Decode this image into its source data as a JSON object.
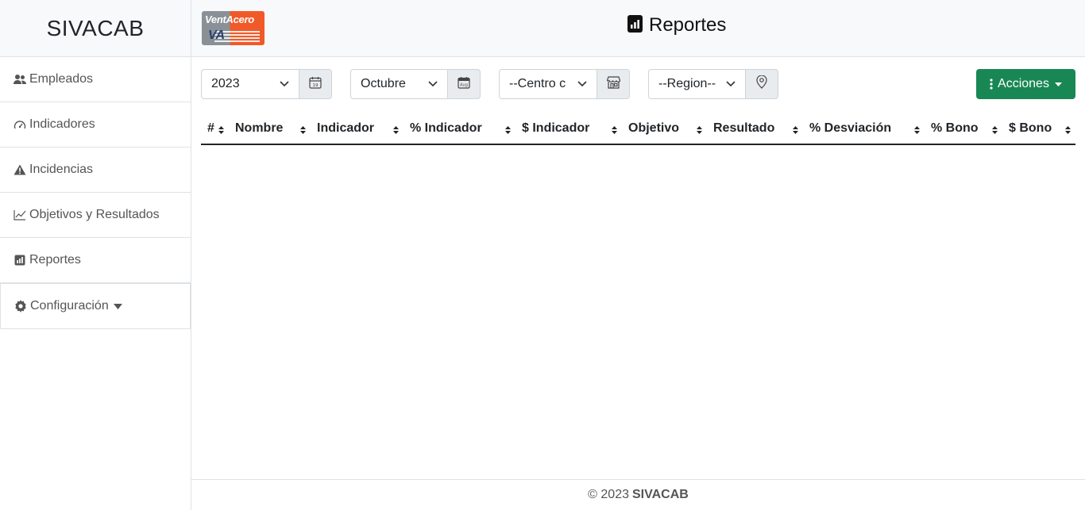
{
  "app": {
    "brand": "SIVACAB"
  },
  "sidebar": {
    "items": [
      {
        "label": "Empleados",
        "icon": "people-icon"
      },
      {
        "label": "Indicadores",
        "icon": "speedometer-icon"
      },
      {
        "label": "Incidencias",
        "icon": "warning-icon"
      },
      {
        "label": "Objetivos y Resultados",
        "icon": "line-chart-icon"
      },
      {
        "label": "Reportes",
        "icon": "report-chart-icon"
      },
      {
        "label": "Configuración",
        "icon": "gear-icon"
      }
    ]
  },
  "header": {
    "logo_text_a": "Vent",
    "logo_text_b": "Acero",
    "logo_mark": "VA",
    "title": "Reportes"
  },
  "filters": {
    "year": {
      "value": "2023",
      "icon": "calendar-icon"
    },
    "month": {
      "value": "Octubre",
      "icon": "calendar-month-icon"
    },
    "center": {
      "value": "--Centro c",
      "icon": "shop-icon"
    },
    "region": {
      "value": "--Region--",
      "icon": "location-pin-icon"
    },
    "actions_label": "Acciones"
  },
  "table": {
    "columns": [
      "#",
      "Nombre",
      "Indicador",
      "% Indicador",
      "$ Indicador",
      "Objetivo",
      "Resultado",
      "% Desviación",
      "% Bono",
      "$ Bono"
    ],
    "rows": []
  },
  "footer": {
    "prefix": "© 2023",
    "brand": "SIVACAB"
  },
  "colors": {
    "accent_green": "#198754",
    "logo_orange": "#f05a28",
    "logo_gray": "#8a9196"
  }
}
